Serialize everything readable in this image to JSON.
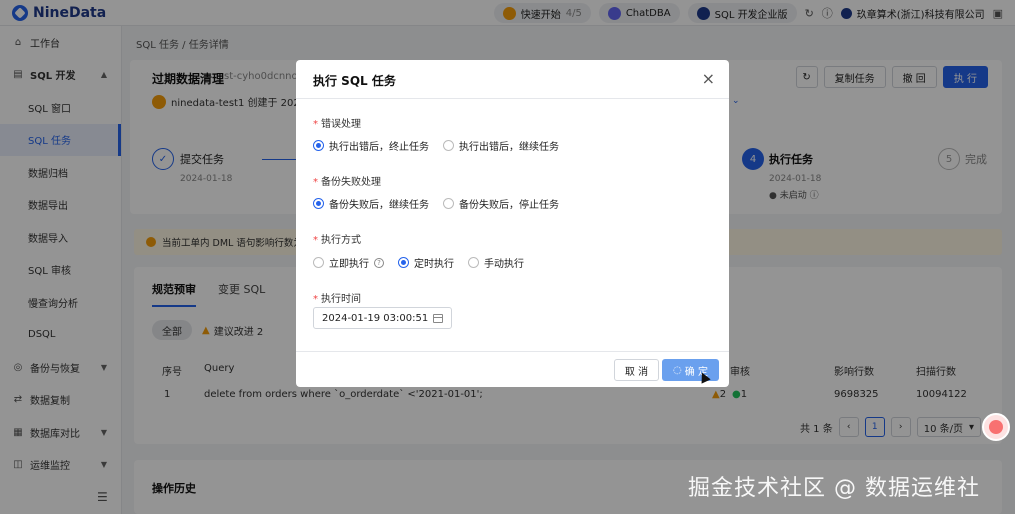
{
  "app": {
    "name": "NineData"
  },
  "header": {
    "quickstart": {
      "label": "快速开始",
      "progress": "4/5"
    },
    "chatdba": "ChatDBA",
    "edition": "SQL 开发企业版",
    "company": "玖章算术(浙江)科技有限公司"
  },
  "sidebar": {
    "items": [
      {
        "label": "工作台",
        "icon": "home-icon"
      },
      {
        "label": "SQL 开发",
        "icon": "sql-dev-icon"
      },
      {
        "label": "SQL 窗口"
      },
      {
        "label": "SQL 任务"
      },
      {
        "label": "数据归档"
      },
      {
        "label": "数据导出"
      },
      {
        "label": "数据导入"
      },
      {
        "label": "SQL 审核"
      },
      {
        "label": "慢查询分析"
      },
      {
        "label": "DSQL"
      },
      {
        "label": "备份与恢复",
        "icon": "backup-icon"
      },
      {
        "label": "数据复制",
        "icon": "replication-icon"
      },
      {
        "label": "数据库对比",
        "icon": "compare-icon"
      },
      {
        "label": "运维监控",
        "icon": "monitor-icon"
      }
    ]
  },
  "breadcrumb": {
    "parent": "SQL 任务",
    "sep": "/",
    "current": "任务详情"
  },
  "task": {
    "title": "过期数据清理",
    "id": "st-cyho0dcnnou",
    "creator": "ninedata-test1 创建于 2024",
    "buttons": {
      "copy": "复制任务",
      "withdraw": "撤 回",
      "execute": "执 行"
    }
  },
  "steps": [
    {
      "title": "提交任务",
      "date": "2024-01-18"
    },
    {
      "num": "4",
      "title": "执行任务",
      "date": "2024-01-18",
      "status": "未启动"
    },
    {
      "num": "5",
      "title": "完成"
    }
  ],
  "warning": "当前工单内 DML 语句影响行数为",
  "tabs": {
    "review": "规范预审",
    "change": "变更 SQL"
  },
  "filters": {
    "all": "全部",
    "suggest": "建议改进 2"
  },
  "table": {
    "headers": {
      "no": "序号",
      "query": "Query",
      "audit": "审核",
      "affected": "影响行数",
      "scanned": "扫描行数"
    },
    "rows": [
      {
        "no": "1",
        "query": "delete from orders where `o_orderdate` <'2021-01-01';",
        "warn": "2",
        "pass": "1",
        "affected": "9698325",
        "scanned": "10094122"
      }
    ]
  },
  "pagination": {
    "total": "共 1 条",
    "page": "1",
    "size": "10 条/页"
  },
  "history": {
    "title": "操作历史"
  },
  "modal": {
    "title": "执行 SQL 任务",
    "error": {
      "label": "错误处理",
      "options": [
        "执行出错后，终止任务",
        "执行出错后，继续任务"
      ],
      "selected": 0
    },
    "backup": {
      "label": "备份失败处理",
      "options": [
        "备份失败后，继续任务",
        "备份失败后，停止任务"
      ],
      "selected": 0
    },
    "mode": {
      "label": "执行方式",
      "options": [
        "立即执行",
        "定时执行",
        "手动执行"
      ],
      "selected": 1
    },
    "time": {
      "label": "执行时间",
      "value": "2024-01-19 03:00:51"
    },
    "cancel": "取 消",
    "ok": "确 定"
  },
  "watermark": "掘金技术社区 @ 数据运维社",
  "colors": {
    "primary": "#2563eb",
    "warn": "#f59e0b",
    "success": "#22c55e"
  }
}
